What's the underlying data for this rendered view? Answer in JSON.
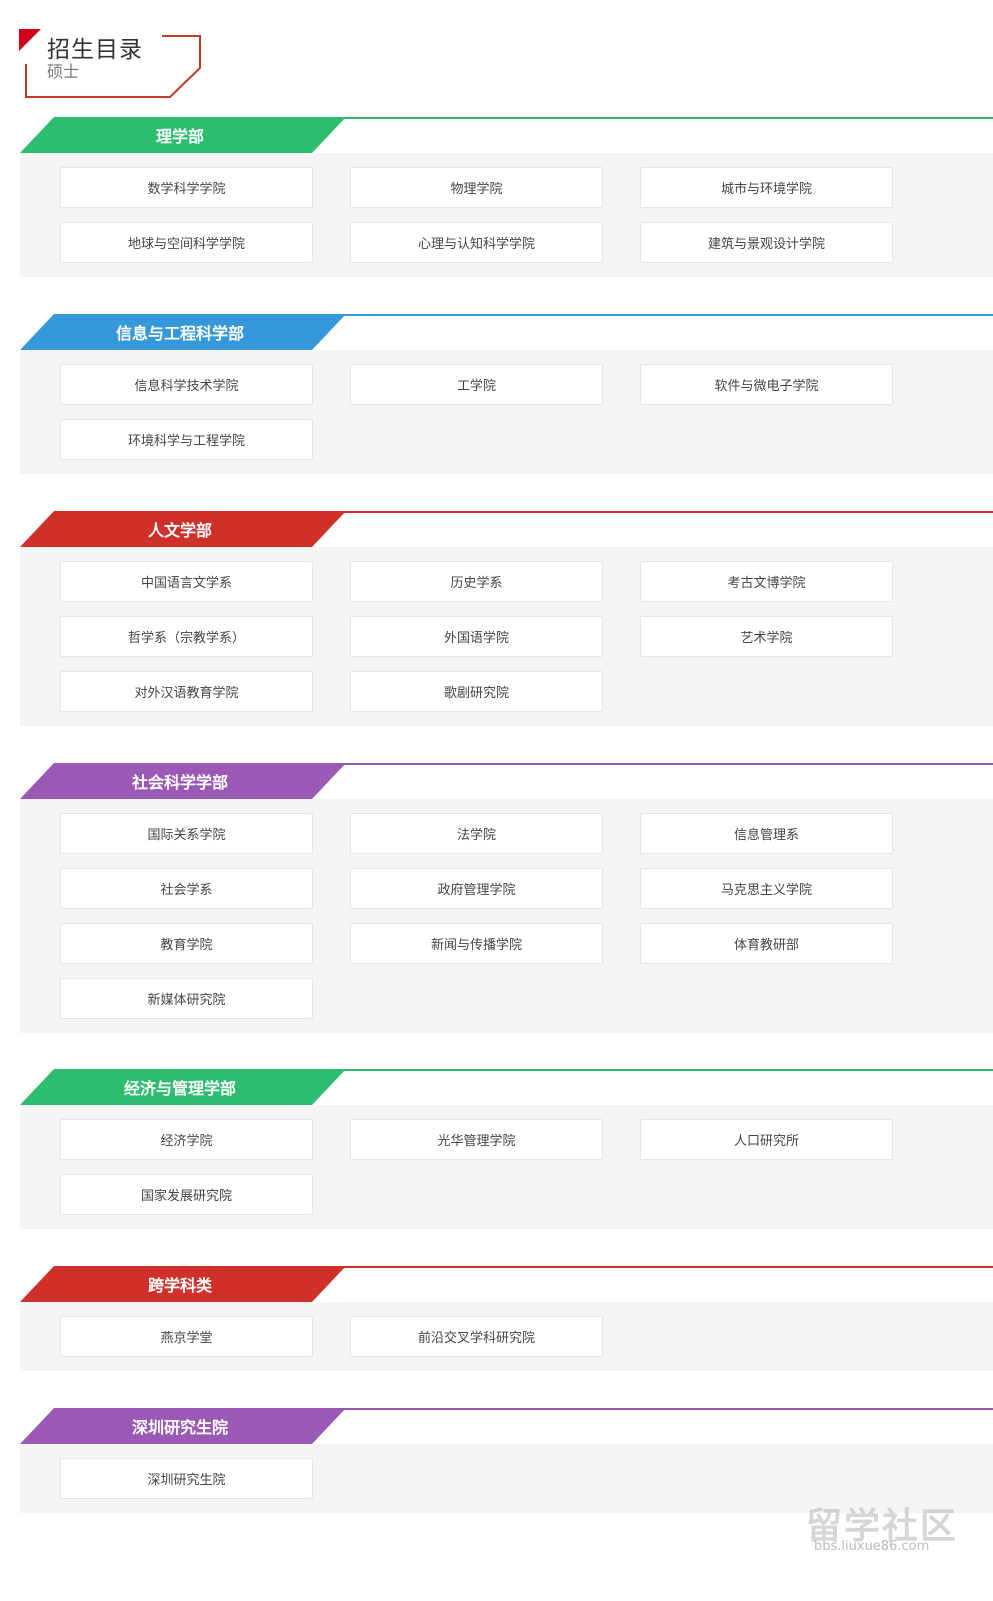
{
  "header": {
    "title": "招生目录",
    "subtitle": "硕士",
    "accent_color": "#d0021b"
  },
  "sections": [
    {
      "title": "理学部",
      "color": "#2dbd6e",
      "items": [
        "数学科学学院",
        "物理学院",
        "城市与环境学院",
        "地球与空间科学学院",
        "心理与认知科学学院",
        "建筑与景观设计学院"
      ]
    },
    {
      "title": "信息与工程科学部",
      "color": "#3498db",
      "items": [
        "信息科学技术学院",
        "工学院",
        "软件与微电子学院",
        "环境科学与工程学院"
      ]
    },
    {
      "title": "人文学部",
      "color": "#d0302a",
      "items": [
        "中国语言文学系",
        "历史学系",
        "考古文博学院",
        "哲学系（宗教学系）",
        "外国语学院",
        "艺术学院",
        "对外汉语教育学院",
        "歌剧研究院"
      ]
    },
    {
      "title": "社会科学学部",
      "color": "#9b59b6",
      "items": [
        "国际关系学院",
        "法学院",
        "信息管理系",
        "社会学系",
        "政府管理学院",
        "马克思主义学院",
        "教育学院",
        "新闻与传播学院",
        "体育教研部",
        "新媒体研究院"
      ]
    },
    {
      "title": "经济与管理学部",
      "color": "#2dbd6e",
      "items": [
        "经济学院",
        "光华管理学院",
        "人口研究所",
        "国家发展研究院"
      ]
    },
    {
      "title": "跨学科类",
      "color": "#d0302a",
      "items": [
        "燕京学堂",
        "前沿交叉学科研究院"
      ]
    },
    {
      "title": "深圳研究生院",
      "color": "#9b59b6",
      "items": [
        "深圳研究生院"
      ]
    }
  ],
  "watermark": {
    "text": "留学社区",
    "url": "bbs.liuxue86.com"
  }
}
